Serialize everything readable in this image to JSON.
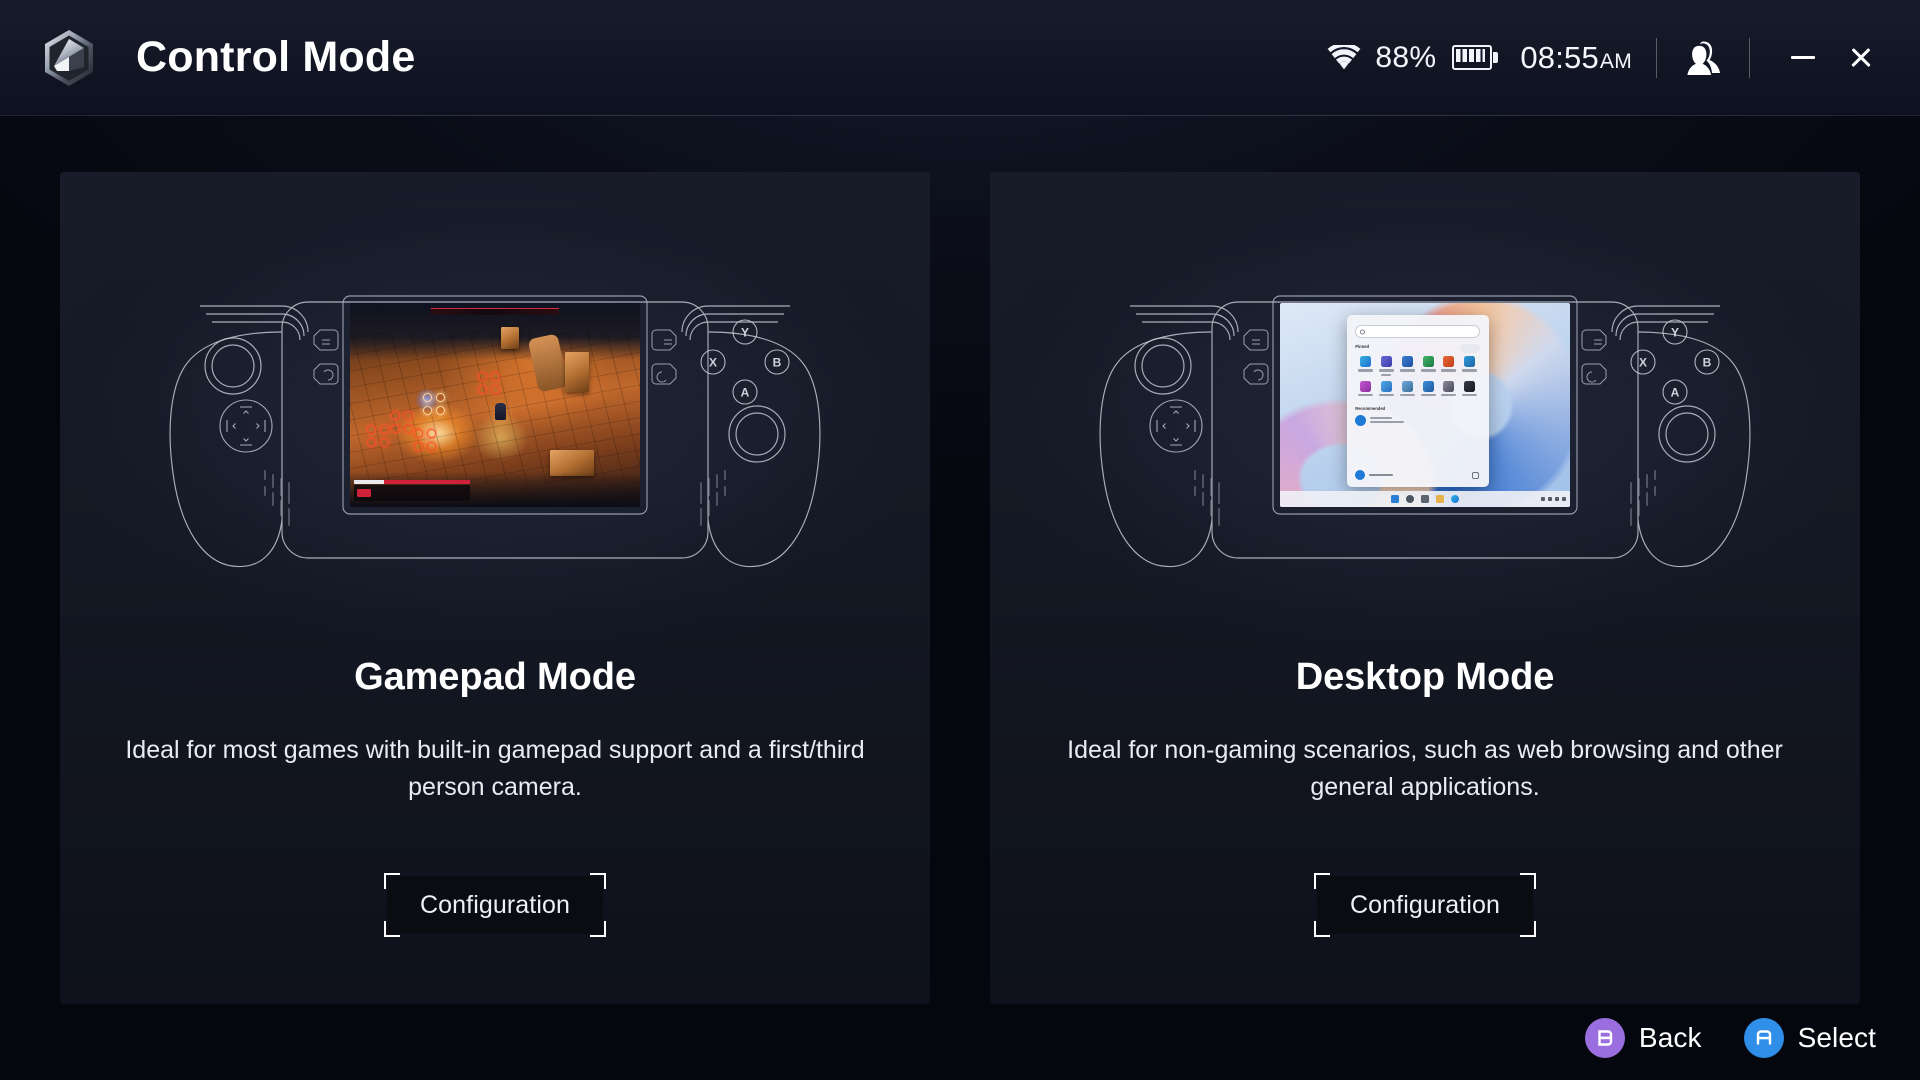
{
  "header": {
    "logo_icon": "armoury-crate-hex-logo",
    "title": "Control Mode",
    "status": {
      "wifi_icon": "wifi-icon",
      "battery_percent": "88%",
      "battery_icon": "battery-full-icon",
      "time": "08:55",
      "meridiem": "AM",
      "avatar_icon": "user-avatar-icon",
      "minimize_icon": "minimize-icon",
      "close_icon": "close-icon"
    }
  },
  "cards": [
    {
      "id": "gamepad-mode",
      "title": "Gamepad Mode",
      "description": "Ideal for most games with built-in gamepad support and a first/third person camera.",
      "button_label": "Configuration",
      "device_screen": "game-screenshot"
    },
    {
      "id": "desktop-mode",
      "title": "Desktop Mode",
      "description": "Ideal for non-gaming scenarios, such as web browsing and other general applications.",
      "button_label": "Configuration",
      "device_screen": "windows-desktop-screenshot"
    }
  ],
  "device": {
    "face_buttons": [
      "Y",
      "X",
      "B",
      "A"
    ],
    "dpad_icon": "dpad-icon",
    "left_stick_icon": "left-analog-stick",
    "right_stick_icon": "right-analog-stick",
    "view_button_icon": "view-button-icon",
    "menu_button_icon": "menu-button-icon",
    "command_center_icon": "command-center-button",
    "armoury_crate_icon": "armoury-crate-button"
  },
  "footer": {
    "hints": [
      {
        "button": "B",
        "label": "Back",
        "color": "#9b6ee0"
      },
      {
        "button": "A",
        "label": "Select",
        "color": "#2f8fe8"
      }
    ]
  },
  "colors": {
    "page_background": "#05070e",
    "titlebar_background": "#141826",
    "card_background": "#191d2a",
    "text_primary": "#ffffff",
    "text_secondary": "#e9ebf1",
    "back_badge": "#9b6ee0",
    "select_badge": "#2f8fe8"
  }
}
